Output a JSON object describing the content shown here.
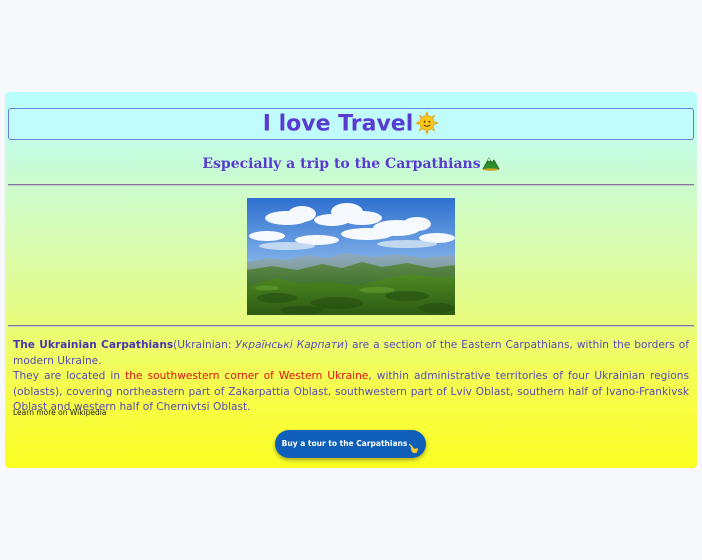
{
  "header": {
    "title": "I love Travel",
    "subtitle": "Especially a trip to the Carpathians"
  },
  "description": {
    "name_bold": "The Ukrainian Carpathians",
    "paren_open": "(Ukrainian: ",
    "native_name": "Українські Карпати",
    "sentence_1": ") are a section of the Eastern Carpathians, within the borders of modern Ukraine.",
    "sentence_2_start": "They are located in ",
    "highlight": "the southwestern corner of Western Ukraine",
    "sentence_2_end": ", within administrative territories of four Ukrainian regions (oblasts), covering northeastern part of Zakarpattia Oblast, southwestern part of Lviv Oblast, southern half of Ivano-Frankivsk Oblast and western half of Chernivtsi Oblast."
  },
  "links": {
    "learn_more": "Learn more on Wikipedia"
  },
  "cta": {
    "buy_label": "Buy a tour to the Carpathians"
  },
  "icons": {
    "title_emoji": "sun-icon",
    "subtitle_emoji": "mountain-icon",
    "button_emoji": "pointing-hand-icon"
  },
  "colors": {
    "accent": "#5a3bd1",
    "highlight": "#e01010",
    "button": "#0f5fb8"
  }
}
